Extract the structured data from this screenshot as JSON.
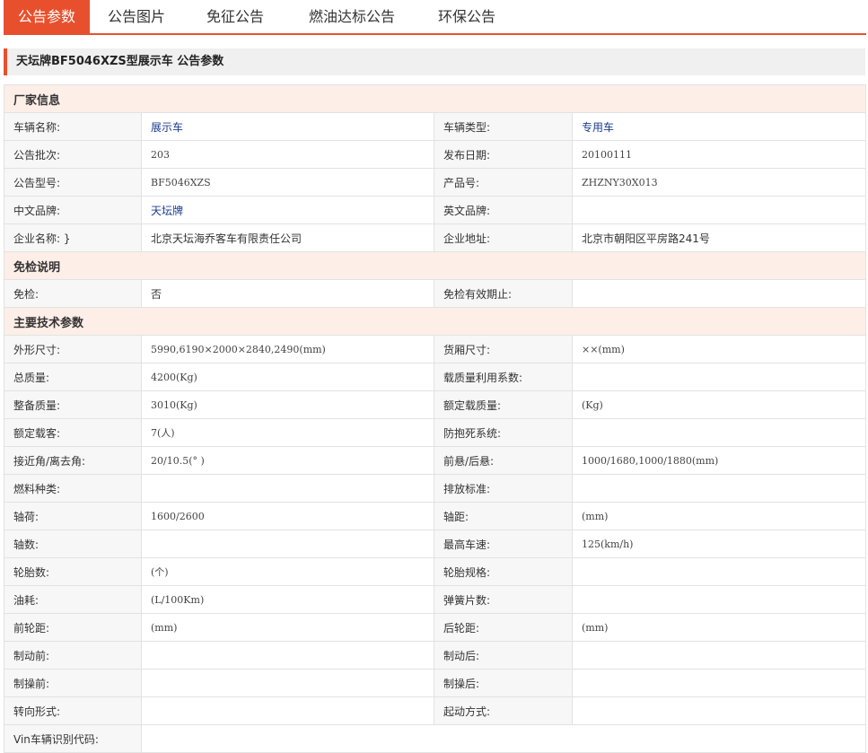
{
  "tabs": [
    "公告参数",
    "公告图片",
    "免征公告",
    "燃油达标公告",
    "环保公告"
  ],
  "active_tab": 0,
  "title": "天坛牌BF5046XZS型展示车 公告参数",
  "colors": {
    "accent": "#e8502d",
    "section_bg": "#fdeee8",
    "link": "#1a3c8c"
  },
  "rows": [
    {
      "type": "section",
      "title": "厂家信息"
    },
    {
      "l1": "车辆名称:",
      "v1": "展示车",
      "v1_style": "link",
      "l2": "车辆类型:",
      "v2": "专用车",
      "v2_style": "link"
    },
    {
      "l1": "公告批次:",
      "v1": "203",
      "l2": "发布日期:",
      "v2": "20100111"
    },
    {
      "l1": "公告型号:",
      "v1": "BF5046XZS",
      "l2": "产品号:",
      "v2": "ZHZNY30X013"
    },
    {
      "l1": "中文品牌:",
      "v1": "天坛牌",
      "v1_style": "link",
      "l2": "英文品牌:",
      "v2": ""
    },
    {
      "l1": "企业名称: }",
      "v1": "北京天坛海乔客车有限责任公司",
      "v1_style": "cn",
      "l2": "企业地址:",
      "v2": "北京市朝阳区平房路241号",
      "v2_style": "cn"
    },
    {
      "type": "section",
      "title": "免检说明"
    },
    {
      "l1": "免检:",
      "v1": "否",
      "v1_style": "cn",
      "l2": "免检有效期止:",
      "v2": ""
    },
    {
      "type": "section",
      "title": "主要技术参数"
    },
    {
      "l1": "外形尺寸:",
      "v1": "5990,6190×2000×2840,2490(mm)",
      "l2": "货厢尺寸:",
      "v2": "××(mm)"
    },
    {
      "l1": "总质量:",
      "v1": "4200(Kg)",
      "l2": "载质量利用系数:",
      "v2": ""
    },
    {
      "l1": "整备质量:",
      "v1": "3010(Kg)",
      "l2": "额定载质量:",
      "v2": "(Kg)"
    },
    {
      "l1": "额定载客:",
      "v1": "7(人)",
      "l2": "防抱死系统:",
      "v2": ""
    },
    {
      "l1": "接近角/离去角:",
      "v1": "20/10.5(° )",
      "l2": "前悬/后悬:",
      "v2": "1000/1680,1000/1880(mm)"
    },
    {
      "l1": "燃料种类:",
      "v1": "",
      "l2": "排放标准:",
      "v2": ""
    },
    {
      "l1": "轴荷:",
      "v1": "1600/2600",
      "l2": "轴距:",
      "v2": "(mm)"
    },
    {
      "l1": "轴数:",
      "v1": "",
      "l2": "最高车速:",
      "v2": "125(km/h)"
    },
    {
      "l1": "轮胎数:",
      "v1": "(个)",
      "l2": "轮胎规格:",
      "v2": ""
    },
    {
      "l1": "油耗:",
      "v1": "(L/100Km)",
      "l2": "弹簧片数:",
      "v2": ""
    },
    {
      "l1": "前轮距:",
      "v1": "(mm)",
      "l2": "后轮距:",
      "v2": "(mm)"
    },
    {
      "l1": "制动前:",
      "v1": "",
      "l2": "制动后:",
      "v2": ""
    },
    {
      "l1": "制操前:",
      "v1": "",
      "l2": "制操后:",
      "v2": ""
    },
    {
      "l1": "转向形式:",
      "v1": "",
      "l2": "起动方式:",
      "v2": ""
    },
    {
      "l1": "Vin车辆识别代码:",
      "v1": "",
      "l2": "",
      "v2": "",
      "span": true
    }
  ]
}
